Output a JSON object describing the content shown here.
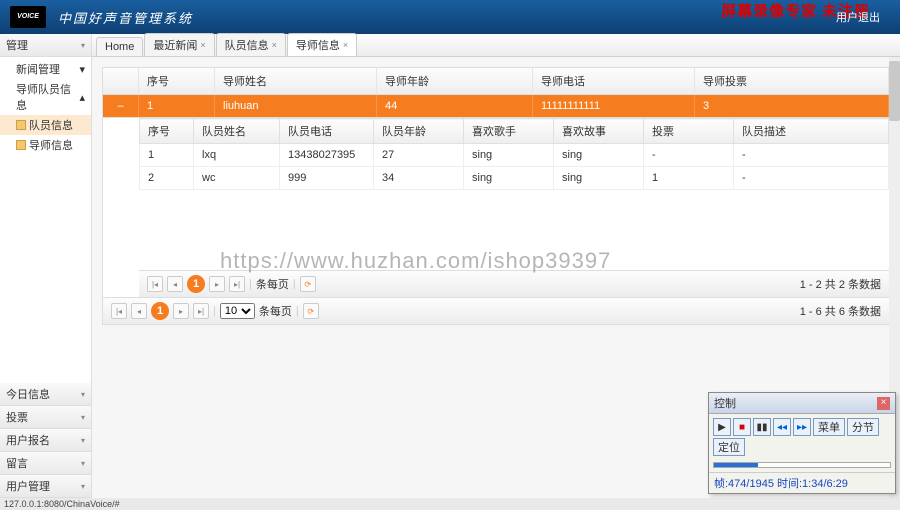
{
  "header": {
    "logo_text": "VOICE",
    "title": "中国好声音管理系统",
    "logout": "用户退出",
    "watermark": "屏幕录像专家 未注册"
  },
  "sidebar": {
    "top": {
      "title": "管理",
      "items": [
        "新闻管理",
        "导师队员信息"
      ],
      "tree": [
        "队员信息",
        "导师信息"
      ]
    },
    "bottom": [
      {
        "label": "今日信息"
      },
      {
        "label": "投票"
      },
      {
        "label": "用户报名"
      },
      {
        "label": "留言"
      },
      {
        "label": "用户管理"
      }
    ]
  },
  "tabs": [
    {
      "label": "Home",
      "closable": false
    },
    {
      "label": "最近新闻",
      "closable": true
    },
    {
      "label": "队员信息",
      "closable": true
    },
    {
      "label": "导师信息",
      "closable": true,
      "active": true
    }
  ],
  "grid": {
    "columns": [
      "序号",
      "导师姓名",
      "导师年龄",
      "导师电话",
      "导师投票"
    ],
    "row": {
      "no": "1",
      "name": "liuhuan",
      "age": "44",
      "phone": "11111111111",
      "vote": "3"
    },
    "sub_columns": [
      "序号",
      "队员姓名",
      "队员电话",
      "队员年龄",
      "喜欢歌手",
      "喜欢故事",
      "投票",
      "队员描述"
    ],
    "sub_rows": [
      {
        "no": "1",
        "name": "lxq",
        "phone": "13438027395",
        "age": "27",
        "singer": "sing",
        "story": "sing",
        "vote": "-",
        "desc": "-"
      },
      {
        "no": "2",
        "name": "wc",
        "phone": "999",
        "age": "34",
        "singer": "sing",
        "story": "sing",
        "vote": "1",
        "desc": "-"
      }
    ]
  },
  "pager_inner": {
    "page": "1",
    "label": "条每页",
    "info": "1 - 2 共 2 条数据"
  },
  "pager_outer": {
    "page": "1",
    "perpage": "10",
    "label": "条每页",
    "info": "1 - 6 共 6 条数据"
  },
  "url_watermark": "https://www.huzhan.com/ishop39397",
  "statusbar": "127.0.0.1:8080/ChinaVoice/#",
  "ctrl": {
    "title": "控制",
    "buttons": [
      "菜单",
      "分节",
      "定位"
    ],
    "status": "帧:474/1945 时间:1:34/6:29"
  }
}
